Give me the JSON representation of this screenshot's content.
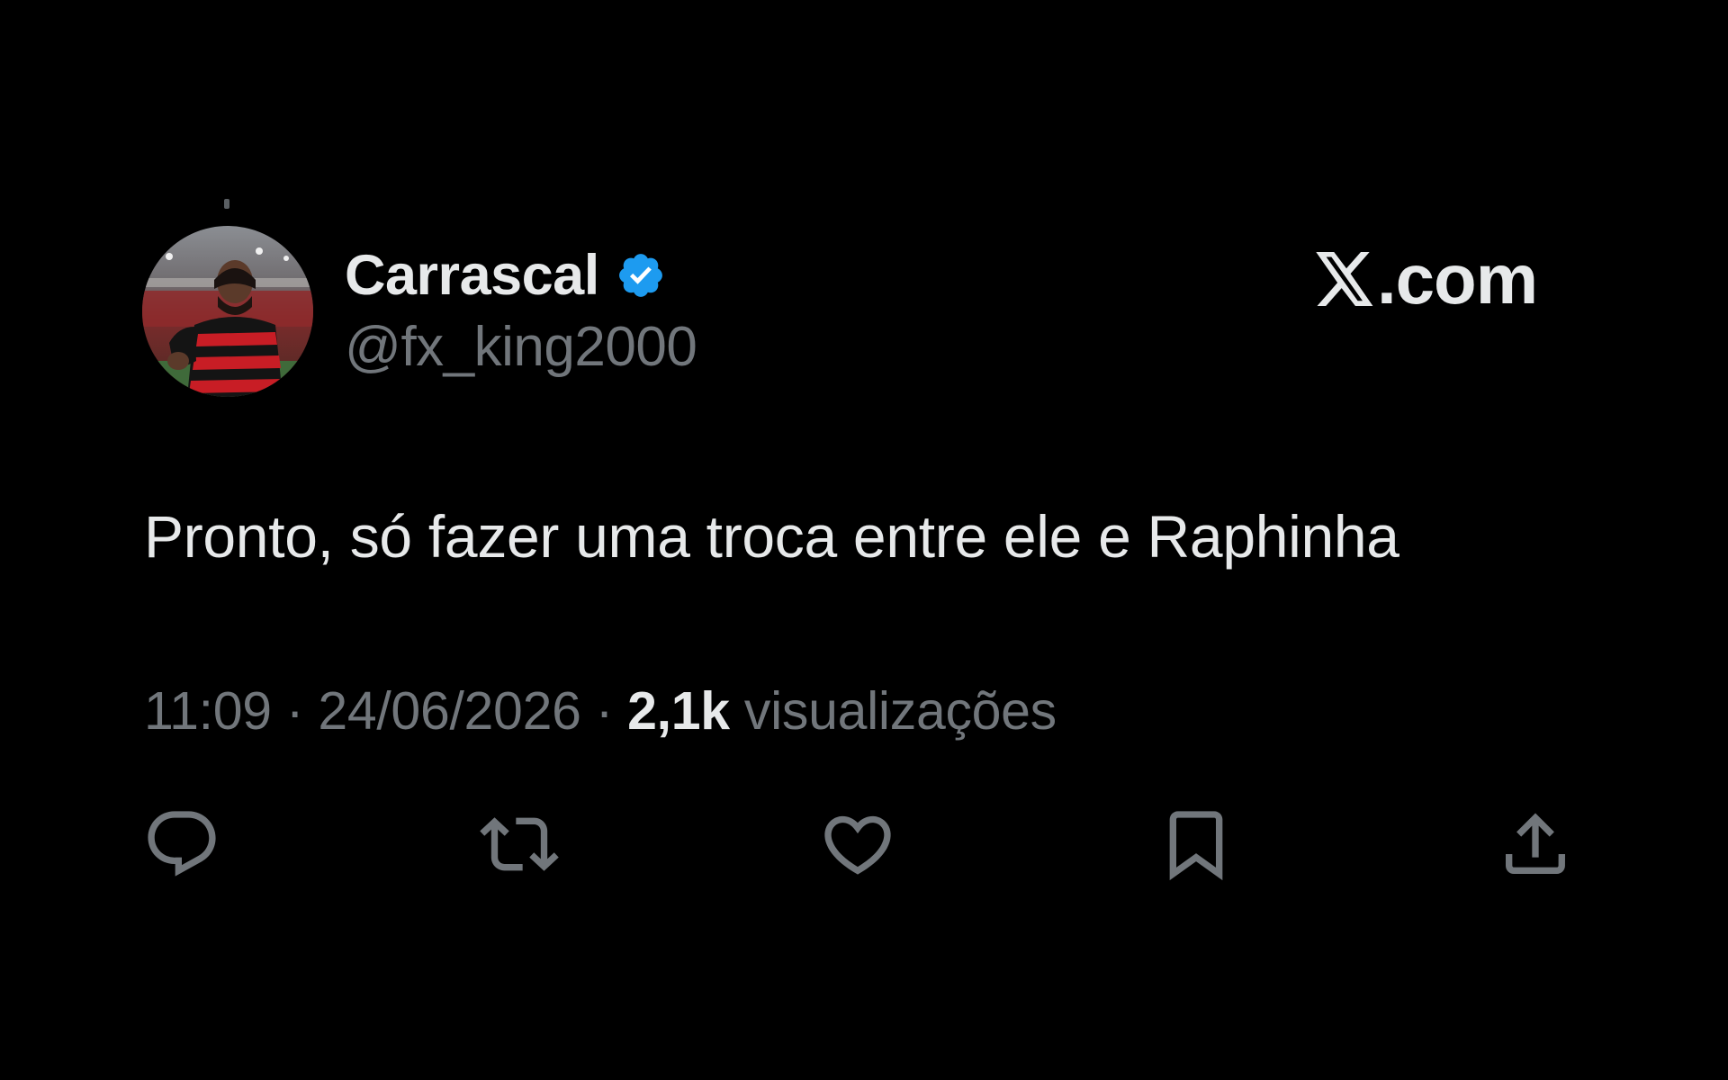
{
  "author": {
    "display_name": "Carrascal",
    "handle": "@fx_king2000",
    "verified": true,
    "avatar_icon": "avatar-photo"
  },
  "brand": {
    "text": ".com",
    "logo_icon": "x-logo-icon"
  },
  "tweet": {
    "text": "Pronto, só fazer uma troca entre ele e Raphinha"
  },
  "meta": {
    "time": "11:09",
    "separator": " · ",
    "date": "24/06/2026",
    "views_count": "2,1k",
    "views_label": " visualizações"
  },
  "actions": [
    {
      "name": "reply",
      "icon": "reply-icon"
    },
    {
      "name": "repost",
      "icon": "repost-icon"
    },
    {
      "name": "like",
      "icon": "heart-icon"
    },
    {
      "name": "bookmark",
      "icon": "bookmark-icon"
    },
    {
      "name": "share",
      "icon": "share-icon"
    }
  ],
  "colors": {
    "background": "#000000",
    "primary_text": "#e7e9ea",
    "secondary_text": "#71767b",
    "verified_blue": "#1d9bf0"
  }
}
